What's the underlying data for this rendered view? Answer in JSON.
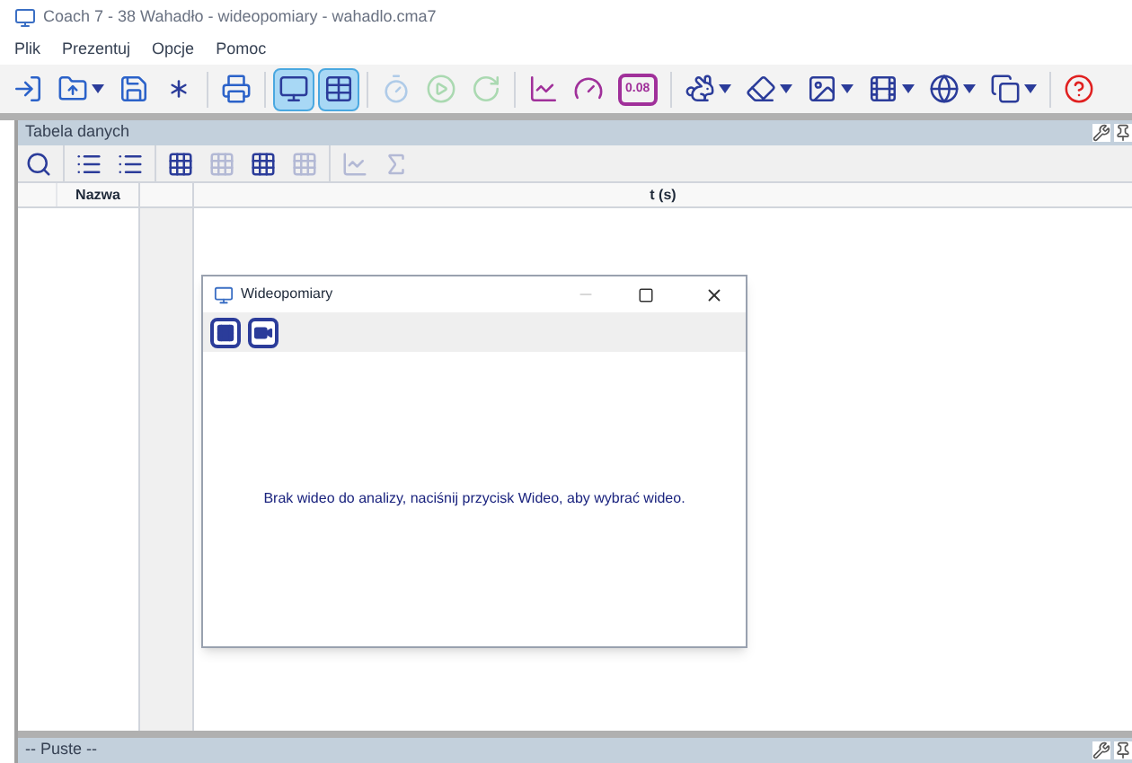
{
  "window": {
    "title": "Coach 7 - 38 Wahadło - wideopomiary - wahadlo.cma7"
  },
  "menu": [
    "Plik",
    "Prezentuj",
    "Opcje",
    "Pomoc"
  ],
  "toolbar": [
    [
      {
        "dropdown": false,
        "selected": false,
        "disabled": false
      },
      {
        "dropdown": true,
        "selected": false,
        "disabled": false
      },
      {
        "dropdown": false,
        "selected": false,
        "disabled": false
      },
      {
        "dropdown": false,
        "selected": false,
        "disabled": false
      }
    ],
    [
      {
        "dropdown": false,
        "selected": false,
        "disabled": false
      }
    ],
    [
      {
        "dropdown": false,
        "selected": true,
        "disabled": false
      },
      {
        "dropdown": false,
        "selected": true,
        "disabled": false
      }
    ],
    [
      {
        "dropdown": false,
        "selected": false,
        "disabled": true
      },
      {
        "dropdown": false,
        "selected": false,
        "disabled": true
      },
      {
        "dropdown": false,
        "selected": false,
        "disabled": true
      }
    ],
    [
      {
        "dropdown": false,
        "selected": false,
        "disabled": false
      },
      {
        "dropdown": false,
        "selected": false,
        "disabled": false
      },
      {
        "dropdown": false,
        "selected": false,
        "disabled": false,
        "label": "0.08"
      }
    ],
    [
      {
        "dropdown": true,
        "selected": false,
        "disabled": false
      },
      {
        "dropdown": true,
        "selected": false,
        "disabled": false
      },
      {
        "dropdown": true,
        "selected": false,
        "disabled": false
      },
      {
        "dropdown": true,
        "selected": false,
        "disabled": false
      },
      {
        "dropdown": true,
        "selected": false,
        "disabled": false
      },
      {
        "dropdown": true,
        "selected": false,
        "disabled": false
      }
    ],
    [
      {
        "dropdown": false,
        "selected": false,
        "disabled": false
      }
    ]
  ],
  "panel": {
    "title": "Tabela danych",
    "toolbar": [
      [
        {
          "disabled": false
        }
      ],
      [
        {
          "disabled": false
        },
        {
          "disabled": false
        }
      ],
      [
        {
          "disabled": false
        },
        {
          "disabled": true
        },
        {
          "disabled": false
        },
        {
          "disabled": true
        }
      ],
      [
        {
          "disabled": true
        },
        {
          "disabled": true
        }
      ]
    ],
    "table": {
      "columns": [
        "Nazwa",
        "t (s)"
      ]
    }
  },
  "dialog": {
    "title": "Wideopomiary",
    "toolbar": [
      {
        "selected": false
      },
      {
        "selected": false
      }
    ],
    "message": "Brak wideo do analizy, naciśnij przycisk Wideo, aby wybrać wideo."
  },
  "bottom_panel": {
    "title": "-- Puste --"
  }
}
